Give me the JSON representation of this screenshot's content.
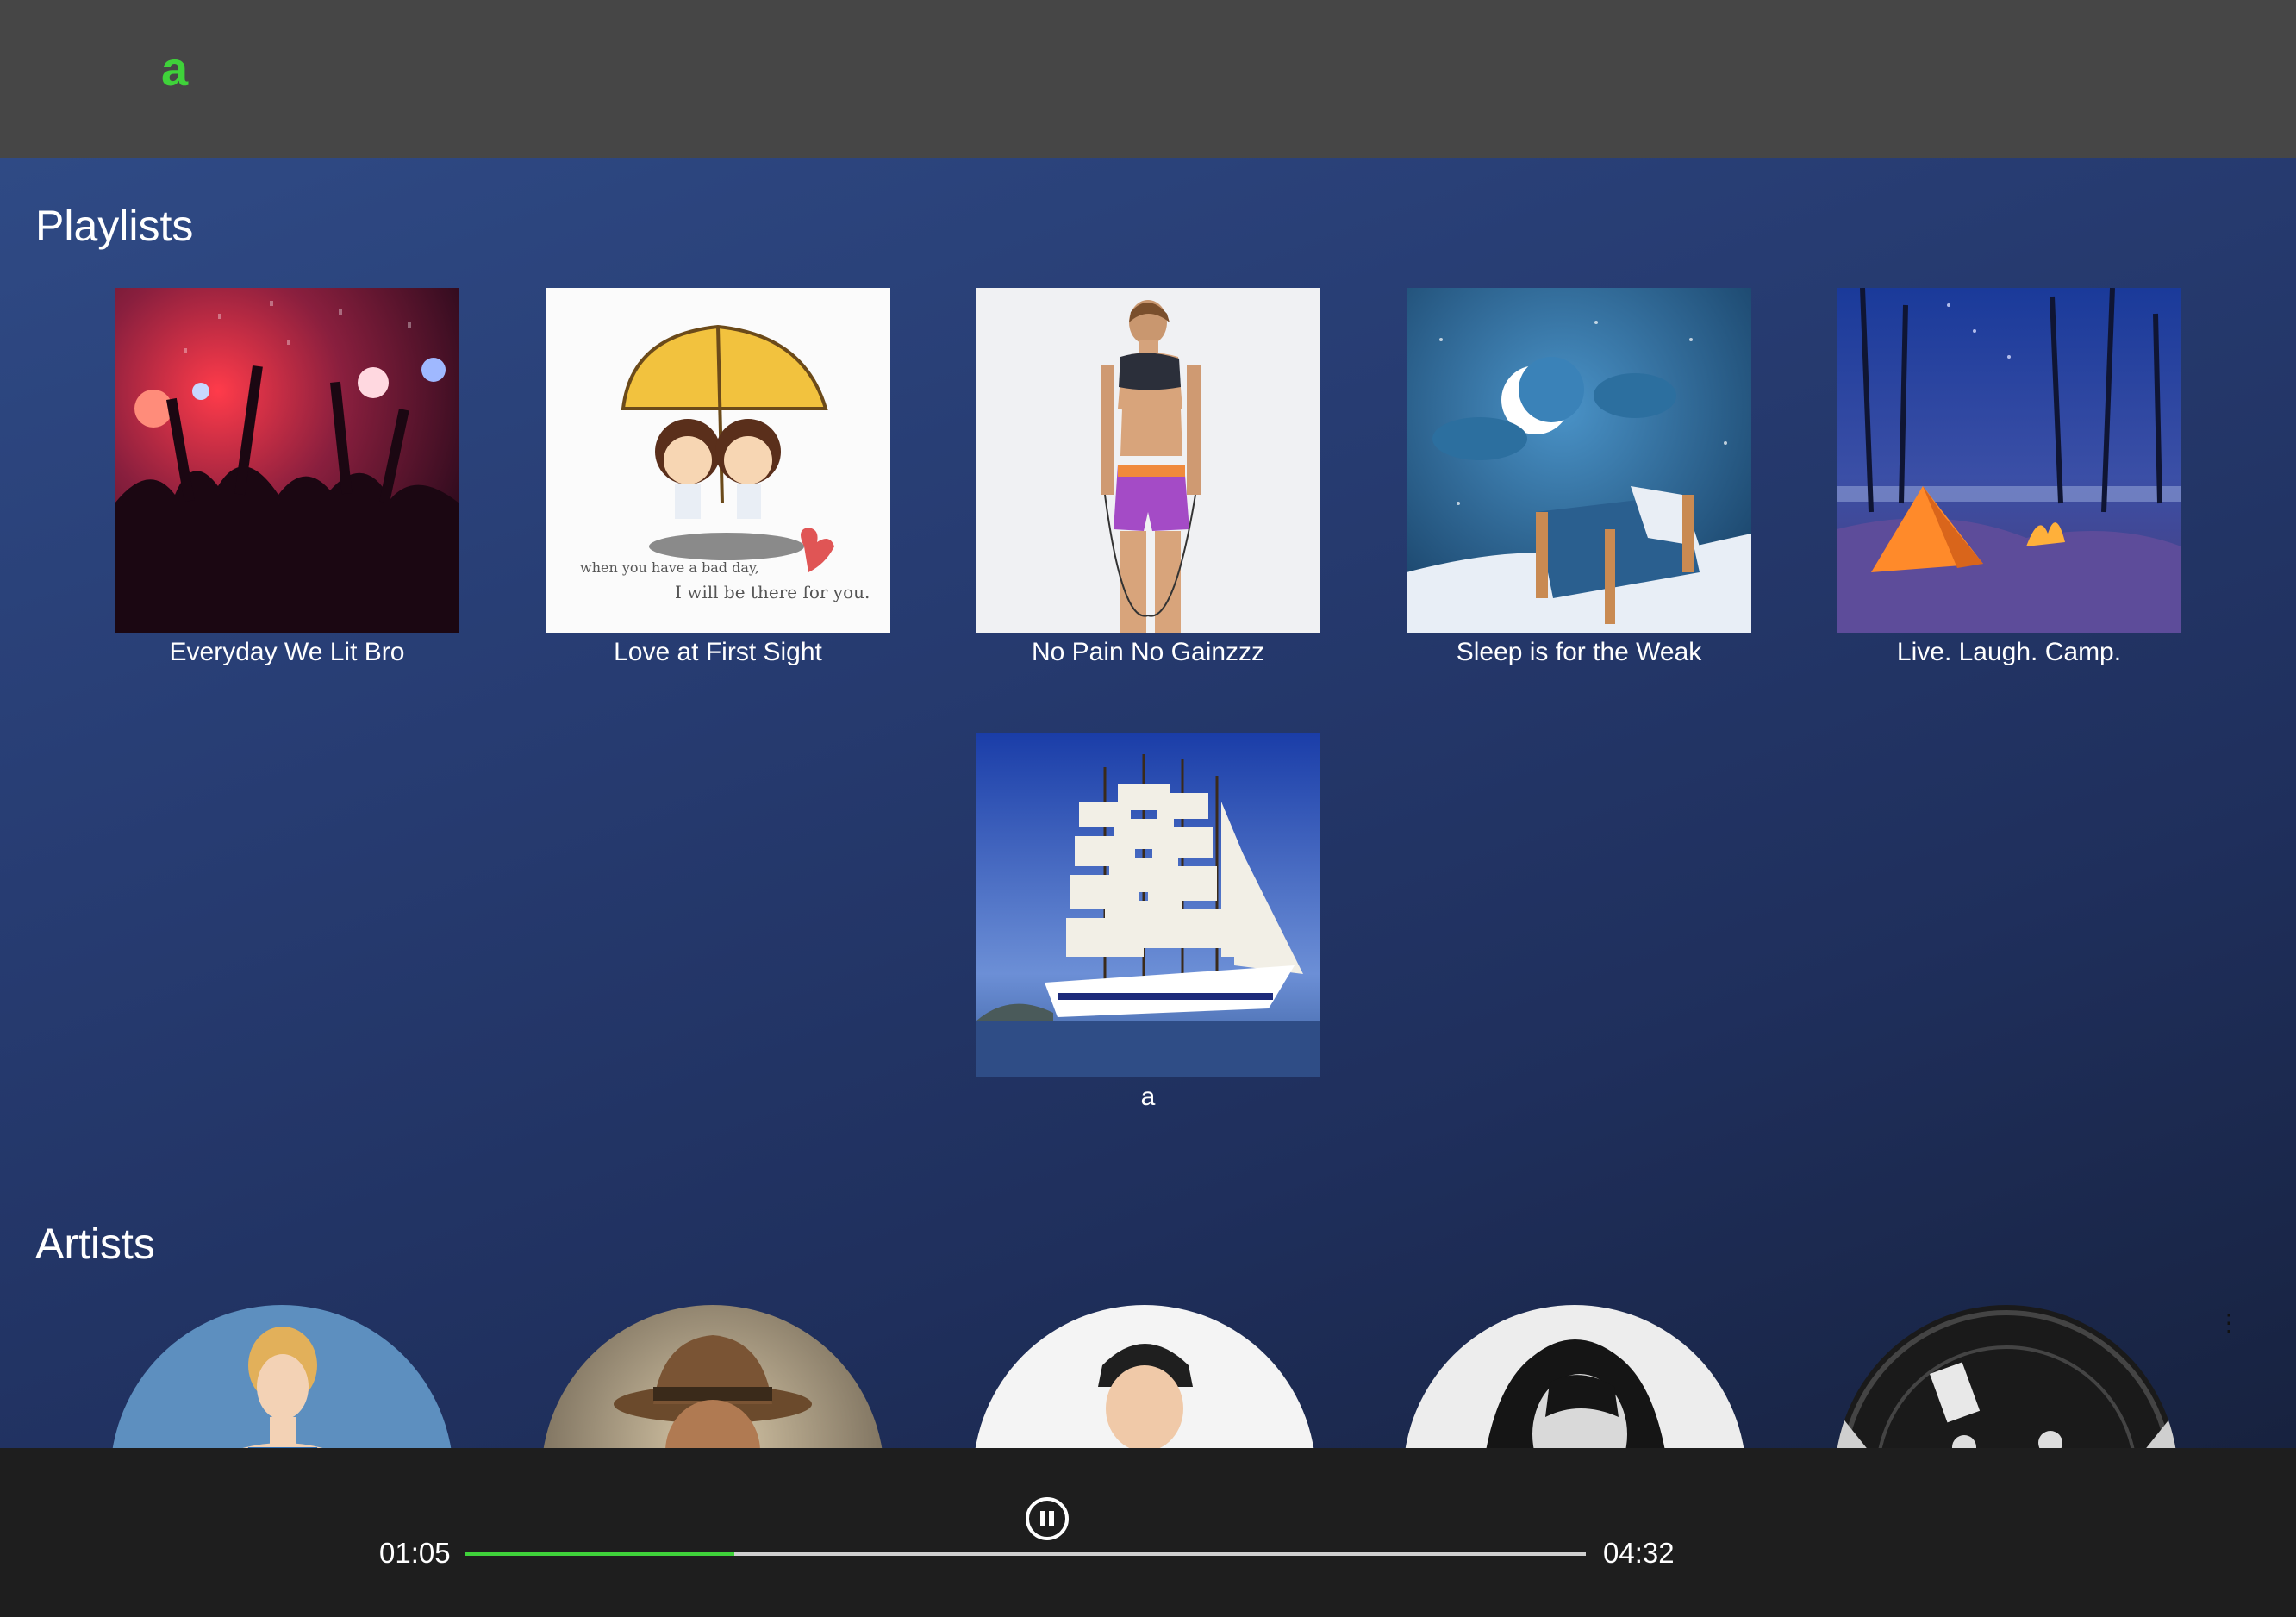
{
  "header": {
    "logo_text": "a"
  },
  "colors": {
    "accent": "#3fd23a",
    "header_bg": "#464646",
    "player_bg": "#1e1e1e"
  },
  "sections": {
    "playlists_title": "Playlists",
    "artists_title": "Artists"
  },
  "playlists": [
    {
      "name": "Everyday We Lit Bro",
      "image": "concert-crowd-image"
    },
    {
      "name": "Love at First Sight",
      "image": "couple-umbrella-image",
      "image_text_1": "when you have a bad day,",
      "image_text_2": "I will be there for you."
    },
    {
      "name": "No Pain No Gainzzz",
      "image": "fitness-woman-image"
    },
    {
      "name": "Sleep is for the Weak",
      "image": "night-bed-moon-image"
    },
    {
      "name": "Live. Laugh. Camp.",
      "image": "tent-campfire-image"
    },
    {
      "name": "a",
      "image": "tall-ship-image"
    }
  ],
  "artists": [
    {
      "image": "artist-photo-1"
    },
    {
      "image": "artist-photo-2"
    },
    {
      "image": "artist-photo-3"
    },
    {
      "image": "artist-photo-4"
    },
    {
      "image": "artist-photo-5"
    }
  ],
  "player": {
    "current_time": "01:05",
    "total_time": "04:32",
    "progress_fraction": 0.24,
    "pause_icon": "pause-icon"
  }
}
